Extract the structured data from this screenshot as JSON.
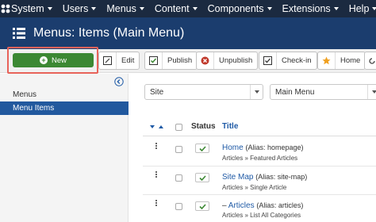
{
  "topnav": {
    "logo_icon": "joomla-icon",
    "items": [
      "System",
      "Users",
      "Menus",
      "Content",
      "Components",
      "Extensions",
      "Help"
    ]
  },
  "header": {
    "icon": "list-icon",
    "title": "Menus: Items (Main Menu)"
  },
  "toolbar": {
    "new_label": "New",
    "edit_label": "Edit",
    "publish_label": "Publish",
    "unpublish_label": "Unpublish",
    "checkin_label": "Check-in",
    "home_label": "Home"
  },
  "sidebar": {
    "items": [
      {
        "label": "Menus",
        "active": false
      },
      {
        "label": "Menu Items",
        "active": true
      }
    ]
  },
  "filters": {
    "client": "Site",
    "menu": "Main Menu"
  },
  "table": {
    "headers": {
      "status": "Status",
      "title": "Title"
    },
    "rows": [
      {
        "title": "Home",
        "alias": "(Alias: homepage)",
        "sub": "Articles » Featured Articles",
        "prefix": ""
      },
      {
        "title": "Site Map",
        "alias": "(Alias: site-map)",
        "sub": "Articles » Single Article",
        "prefix": ""
      },
      {
        "title": "Articles",
        "alias": "(Alias: articles)",
        "sub": "Articles » List All Categories",
        "prefix": "–"
      }
    ]
  },
  "colors": {
    "topnav_bg": "#1b2a40",
    "header_bg": "#1b3d6e",
    "new_button": "#3c8833",
    "highlight_border": "#e8635a",
    "active_sidebar": "#22599e",
    "link": "#1f5aa6"
  }
}
